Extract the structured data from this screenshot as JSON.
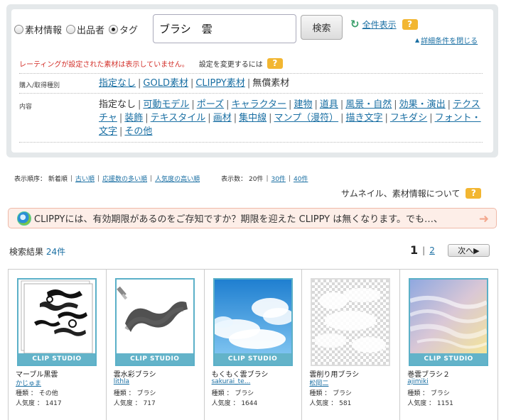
{
  "search": {
    "radio_options": [
      {
        "label": "素材情報",
        "checked": false
      },
      {
        "label": "出品者",
        "checked": false
      },
      {
        "label": "タグ",
        "checked": true
      }
    ],
    "query": "ブラシ　雲",
    "button_label": "検索",
    "reset_label": "全件表示",
    "help_label": "?",
    "close_detail_label": "詳細条件を閉じる"
  },
  "notice": {
    "rating_notice": "レーティングが設定された素材は表示していません。",
    "setting_label": "設定を変更するには"
  },
  "filters": {
    "purchase": {
      "label": "購入/取得種別",
      "options": [
        "指定なし",
        "GOLD素材",
        "CLIPPY素材"
      ],
      "selected": "無償素材"
    },
    "content": {
      "label": "内容",
      "selected": "指定なし",
      "line1": [
        "可動モデル",
        "ポーズ",
        "キャラクター",
        "建物",
        "道具",
        "風景・自然",
        "効果・演出",
        "テクス"
      ],
      "line2": [
        "チャ",
        "装飾",
        "テキスタイル",
        "画材",
        "集中線",
        "マンプ（漫符）",
        "描き文字",
        "フキダシ",
        "フォント・"
      ],
      "line3": [
        "文字",
        "その他"
      ]
    }
  },
  "sort": {
    "label": "表示順序：",
    "current": "新着順",
    "options": [
      "古い順",
      "応援数の多い順",
      "人気度の高い順"
    ],
    "count_label": "表示数：",
    "count_current": "20件",
    "count_options": [
      "30件",
      "40件"
    ]
  },
  "thumb_info_label": "サムネイル、素材情報について",
  "banner": {
    "text": "CLIPPYには、有効期限があるのをご存知ですか？期限を迎えた CLIPPY は無くなります。でも…、"
  },
  "results": {
    "label": "検索結果",
    "count": "24件",
    "pages": [
      "1",
      "2"
    ],
    "next_label": "次へ▶"
  },
  "items": [
    {
      "title": "マーブル黒雲",
      "author": "かじゅま",
      "kind": "種類 ： その他",
      "popularity": "人気度 ： 1417",
      "brand": "CLIP STUDIO",
      "art": "marble-cloud"
    },
    {
      "title": "雲水彩ブラシ",
      "author": "lithla",
      "kind": "種類 ： ブラシ",
      "popularity": "人気度 ： 717",
      "brand": "CLIP STUDIO",
      "art": "watercolor-brush"
    },
    {
      "title": "もくもく雲ブラシ",
      "author": "sakurai_te...",
      "kind": "種類 ： ブラシ",
      "popularity": "人気度 ： 1644",
      "brand": "CLIP STUDIO",
      "art": "sky-cloud"
    },
    {
      "title": "雲削り用ブラシ",
      "author": "松岡二",
      "kind": "種類 ： ブラシ",
      "popularity": "人気度 ： 581",
      "brand": "",
      "art": "checker-cloud"
    },
    {
      "title": "巻雲ブラシ２",
      "author": "ajimiki",
      "kind": "種類 ： ブラシ",
      "popularity": "人気度 ： 1151",
      "brand": "CLIP STUDIO",
      "art": "cirrus-cloud"
    }
  ],
  "colors": {
    "link": "#1a6fa3",
    "accent_teal": "#63b3c9",
    "help_orange": "#f2b631",
    "notice_red": "#d3302a",
    "banner_bg": "#fdeee8"
  }
}
